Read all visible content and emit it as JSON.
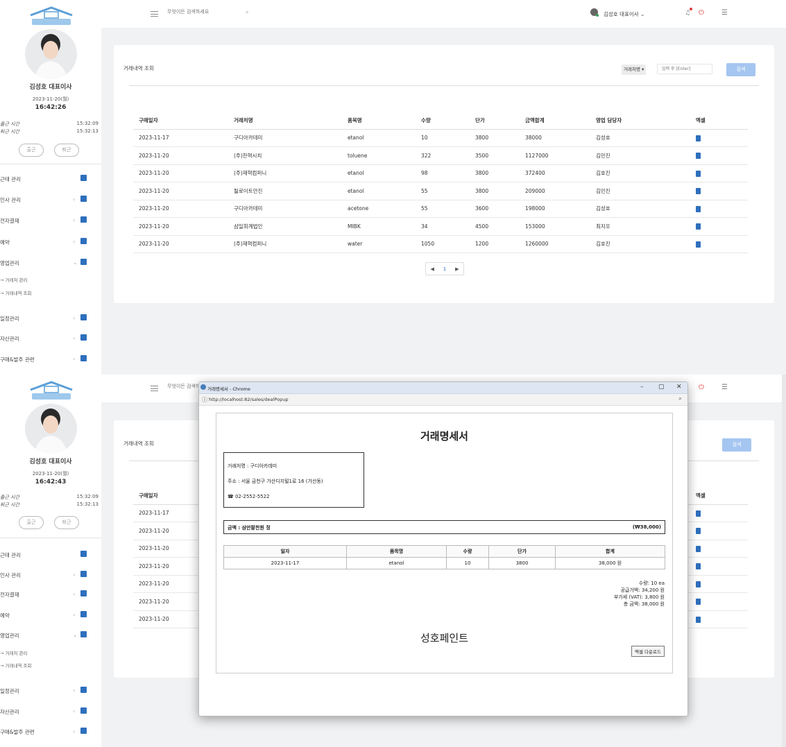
{
  "app": {
    "logo_alt": "성호페인트",
    "search_placeholder": "무엇이든 검색하세요",
    "user_label": "김성호 대표이사",
    "user_caret": "⌄"
  },
  "sidebar": {
    "name": "김성호 대표이사",
    "shot1": {
      "date": "2023-11-20(월)",
      "time": "16:42:26"
    },
    "shot2": {
      "date": "2023-11-20(월)",
      "time": "16:42:43"
    },
    "checkin_label": "출근 시간",
    "checkin_time": "15:32:09",
    "checkout_label": "퇴근 시간",
    "checkout_time": "15:32:13",
    "btn_in": "출근",
    "btn_out": "퇴근",
    "menu": [
      {
        "label": "근태 관리",
        "arrow": ""
      },
      {
        "label": "인사 관리",
        "arrow": "‹"
      },
      {
        "label": "전자결재",
        "arrow": "‹"
      },
      {
        "label": "예약",
        "arrow": "‹"
      },
      {
        "label": "영업관리",
        "arrow": "⌄"
      },
      {
        "label": "일정관리",
        "arrow": "‹"
      },
      {
        "label": "자산관리",
        "arrow": "‹"
      },
      {
        "label": "구매&발주 관련",
        "arrow": "‹"
      }
    ],
    "submenu": [
      {
        "label": "→ 거래처 관리"
      },
      {
        "label": "→ 거래내역 조회"
      }
    ]
  },
  "page": {
    "title": "거래내역 조회",
    "filter_select": "거래처명 ▾",
    "keyword_placeholder": "입력 후 [Enter]",
    "search_btn": "검색",
    "columns": [
      "구매일자",
      "거래처명",
      "품목명",
      "수량",
      "단가",
      "금액합계",
      "영업 담당자",
      "엑셀"
    ],
    "rows": [
      [
        "2023-11-17",
        "구디아카데미",
        "etanol",
        "10",
        "3800",
        "38000",
        "김성호"
      ],
      [
        "2023-11-20",
        "(주)찬혁시치",
        "toluene",
        "322",
        "3500",
        "1127000",
        "김민진"
      ],
      [
        "2023-11-20",
        "(주)재혁컴퍼니",
        "etanol",
        "98",
        "3800",
        "372400",
        "김호진"
      ],
      [
        "2023-11-20",
        "될로이트안진",
        "etanol",
        "55",
        "3800",
        "209000",
        "김민진"
      ],
      [
        "2023-11-20",
        "구디아카데미",
        "acetone",
        "55",
        "3600",
        "198000",
        "김성호"
      ],
      [
        "2023-11-20",
        "삼일회계법인",
        "MIBK",
        "34",
        "4500",
        "153000",
        "최지우"
      ],
      [
        "2023-11-20",
        "(주)재혁컴퍼니",
        "water",
        "1050",
        "1200",
        "1260000",
        "김호진"
      ]
    ],
    "pager": {
      "prev": "◀",
      "current": "1",
      "next": "▶"
    }
  },
  "popup": {
    "window_title": "거래명세서 - Chrome",
    "url": "http://localhost:82/sales/dealPopup",
    "doc_title": "거래명세서",
    "vendor": "거래처명 : 구디아카데미",
    "address": "주소 : 서울 금천구 가산디지털1로 16 (가산동)",
    "phone": "☎ 02-2552-5522",
    "amount_text": "금액 : 삼만팔천원 정",
    "amount_num": "(₩38,000)",
    "item_columns": [
      "일자",
      "품목명",
      "수량",
      "단가",
      "합계"
    ],
    "items": [
      [
        "2023-11-17",
        "etanol",
        "10",
        "3800",
        "38,000 원"
      ]
    ],
    "summary": [
      "수량: 10 ea",
      "공급가액: 34,200 원",
      "부가세 (VAT): 3,800 원",
      "총 금액: 38,000 원"
    ],
    "company": "성호페인트",
    "download_btn": "엑셀 다운로드"
  },
  "colors": {
    "accent": "#2e6fbd",
    "search_btn": "#a5c6f0",
    "danger": "#e53b3b"
  }
}
